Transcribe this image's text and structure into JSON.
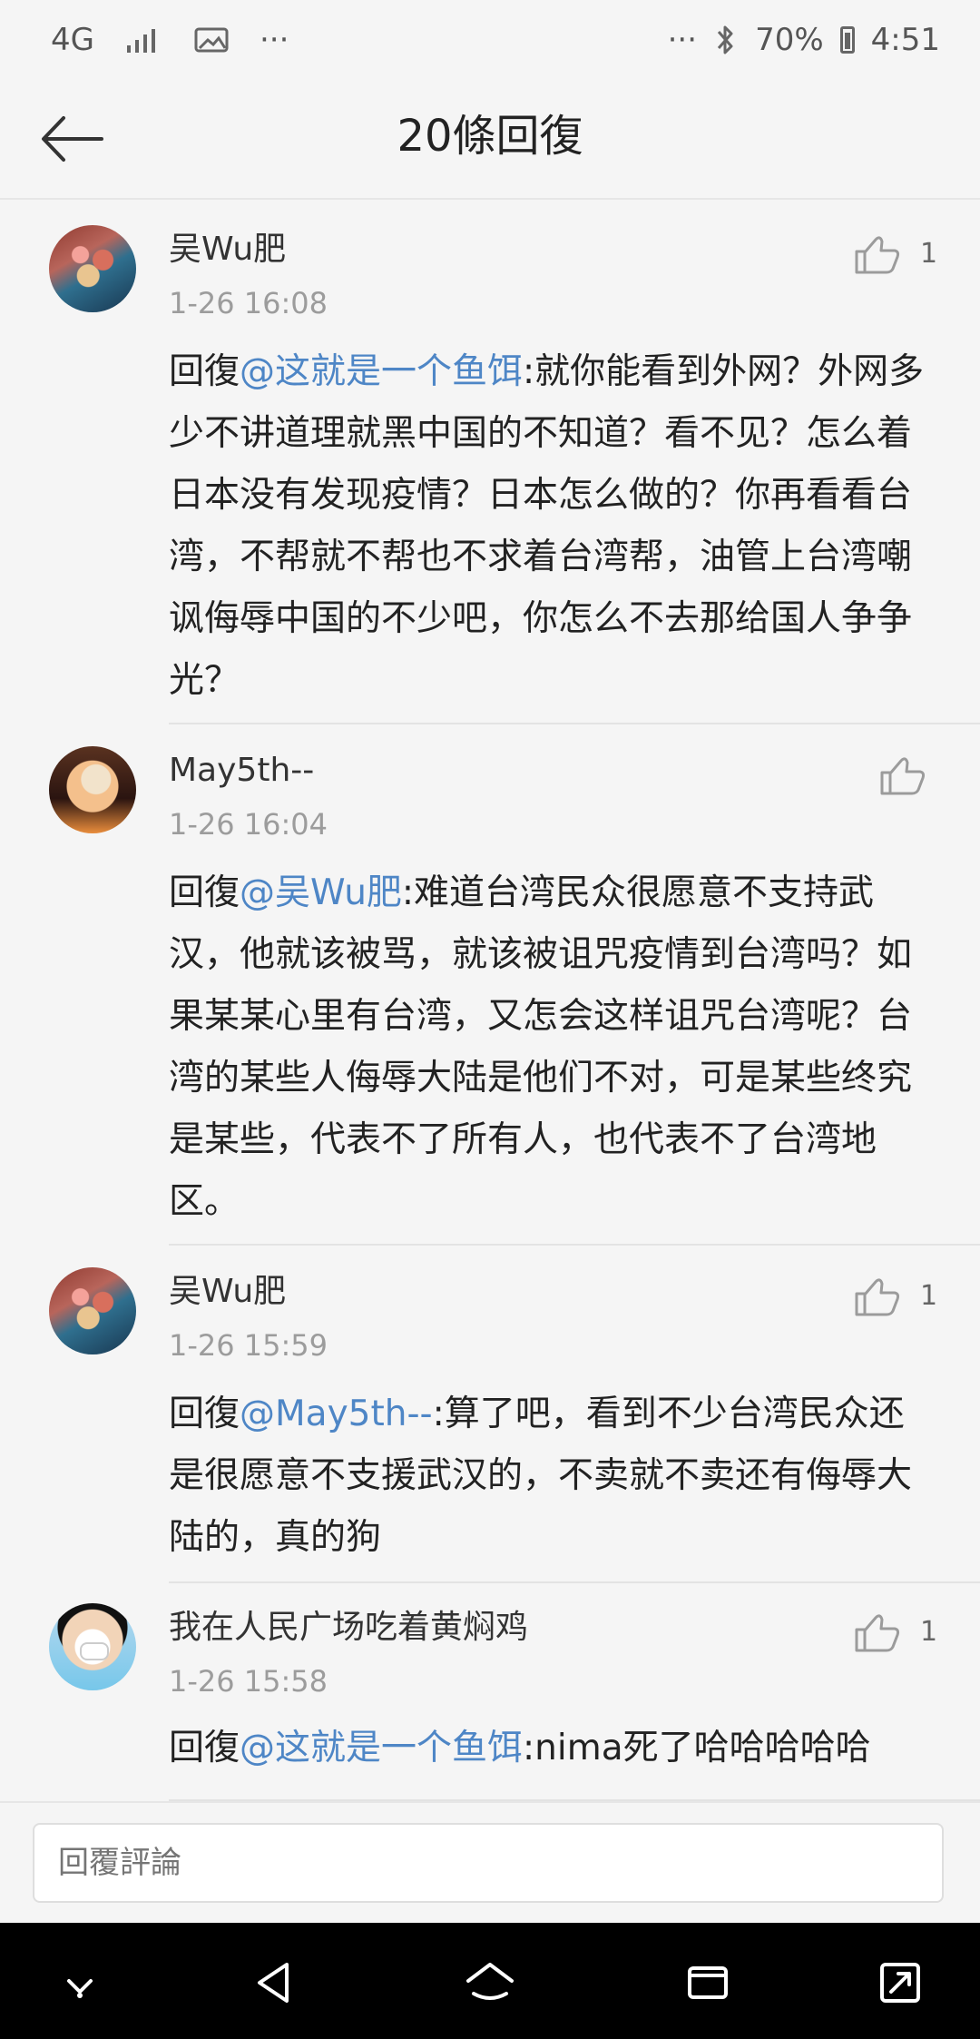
{
  "status_bar": {
    "left": {
      "network": "4G",
      "signal_icon": "signal-icon",
      "image_icon": "image-icon",
      "more": "···"
    },
    "right": {
      "more": "···",
      "bluetooth_icon": "bluetooth-icon",
      "battery": "70%",
      "time": "4:51"
    }
  },
  "header": {
    "title": "20條回復",
    "back_icon": "back-arrow-icon"
  },
  "comments": [
    {
      "author": "吴Wu肥",
      "time": "1-26 16:08",
      "likes": "1",
      "reply_prefix": "回復",
      "mention": "@这就是一个鱼饵",
      "text": ":就你能看到外网？外网多少不讲道理就黑中国的不知道？看不见？怎么着日本没有发现疫情？日本怎么做的？你再看看台湾，不帮就不帮也不求着台湾帮，油管上台湾嘲讽侮辱中国的不少吧，你怎么不去那给国人争争光？",
      "avatar_icon": "avatar-image"
    },
    {
      "author": "May5th--",
      "time": "1-26 16:04",
      "likes": "",
      "reply_prefix": "回復",
      "mention": "@吴Wu肥",
      "text": ":难道台湾民众很愿意不支持武汉，他就该被骂，就该被诅咒疫情到台湾吗？如果某某心里有台湾，又怎会这样诅咒台湾呢？台湾的某些人侮辱大陆是他们不对，可是某些终究是某些，代表不了所有人，也代表不了台湾地区。",
      "avatar_icon": "avatar-image"
    },
    {
      "author": "吴Wu肥",
      "time": "1-26 15:59",
      "likes": "1",
      "reply_prefix": "回復",
      "mention": "@May5th--",
      "text": ":算了吧，看到不少台湾民众还是很愿意不支援武汉的，不卖就不卖还有侮辱大陆的，真的狗",
      "avatar_icon": "avatar-image"
    },
    {
      "author": "我在人民广场吃着黄焖鸡",
      "time": "1-26 15:58",
      "likes": "1",
      "reply_prefix": "回復",
      "mention": "@这就是一个鱼饵",
      "text": ":nima死了哈哈哈哈哈",
      "avatar_icon": "avatar-image"
    }
  ],
  "comment_box": {
    "placeholder": "回覆評論"
  },
  "nav_bar": {
    "buttons": [
      "down-chevron-icon",
      "back-triangle-icon",
      "home-icon",
      "recent-apps-icon",
      "expand-icon"
    ]
  }
}
